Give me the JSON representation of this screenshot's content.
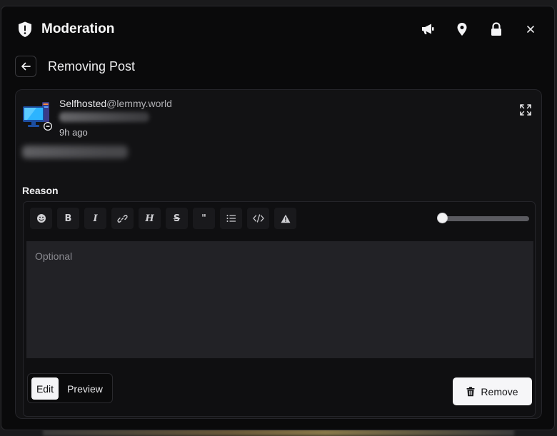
{
  "header": {
    "title": "Moderation",
    "icons": [
      "shield-icon",
      "megaphone-icon",
      "location-pin-icon",
      "lock-icon",
      "close-icon"
    ]
  },
  "subheader": {
    "back_icon": "arrow-left-icon",
    "title": "Removing Post"
  },
  "post": {
    "community_name": "Selfhosted",
    "community_instance": "@lemmy.world",
    "timestamp": "9h ago",
    "expand_icon": "expand-icon"
  },
  "reason": {
    "label": "Reason",
    "placeholder": "Optional",
    "value": "",
    "toolbar": [
      {
        "name": "emoji",
        "icon": "emoji-icon"
      },
      {
        "name": "bold",
        "icon": "bold-icon"
      },
      {
        "name": "italic",
        "icon": "italic-icon"
      },
      {
        "name": "link",
        "icon": "link-icon"
      },
      {
        "name": "header",
        "icon": "header-icon"
      },
      {
        "name": "strikethrough",
        "icon": "strikethrough-icon"
      },
      {
        "name": "quote",
        "icon": "quote-icon"
      },
      {
        "name": "list",
        "icon": "list-icon"
      },
      {
        "name": "code",
        "icon": "code-icon"
      },
      {
        "name": "warning",
        "icon": "warning-icon"
      }
    ],
    "slider_value": 0
  },
  "footer": {
    "edit_label": "Edit",
    "preview_label": "Preview",
    "remove_label": "Remove"
  }
}
